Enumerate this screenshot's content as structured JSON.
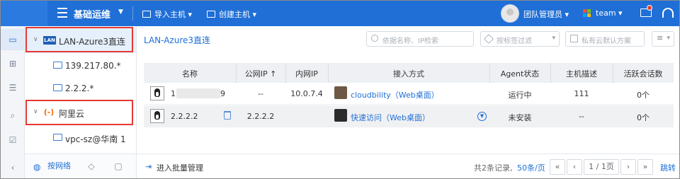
{
  "topbar": {
    "title": "基础运维",
    "menu": [
      {
        "label": "导入主机",
        "icon": "import-host-icon"
      },
      {
        "label": "创建主机",
        "icon": "create-host-icon"
      }
    ],
    "user": "团队管理员",
    "team": "team"
  },
  "tree": {
    "nodes": [
      {
        "label": "LAN-Azure3直连",
        "badge": "LAN",
        "type": "network"
      },
      {
        "label": "139.217.80.*",
        "type": "host"
      },
      {
        "label": "2.2.2.*",
        "type": "host"
      },
      {
        "label": "阿里云",
        "badge": "(-)",
        "type": "cloud"
      },
      {
        "label": "vpc-sz@华南 1",
        "type": "host"
      }
    ],
    "tabs": {
      "network": "按网络"
    }
  },
  "breadcrumb": "LAN-Azure3直连",
  "filters": {
    "search_placeholder": "依据名称、IP检索",
    "tag_placeholder": "按标签过滤",
    "scheme_placeholder": "私有云默认方案"
  },
  "table": {
    "headers": [
      "名称",
      "公网IP ↑",
      "内网IP",
      "接入方式",
      "Agent状态",
      "主机描述",
      "活跃会话数"
    ],
    "rows": [
      {
        "name_suffix": "9",
        "name_prefix": "1",
        "public_ip": "--",
        "private_ip": "10.0.7.4",
        "access": "cloudbility（Web桌面）",
        "agent": "运行中",
        "desc": "111",
        "sessions": "0个"
      },
      {
        "name": "2.2.2.2",
        "public_ip": "2.2.2.2",
        "private_ip": "",
        "access": "快速访问（Web桌面）",
        "agent": "未安装",
        "desc": "--",
        "sessions": "0个"
      }
    ]
  },
  "footer": {
    "batch": "进入批量管理",
    "total": "共2条记录,",
    "page_size": "50条/页",
    "page": "1 / 1页",
    "jump": "跳转"
  },
  "colors": {
    "brand": "#1f6fd6",
    "highlight": "#e53935",
    "aliyun": "#ff6a00"
  }
}
